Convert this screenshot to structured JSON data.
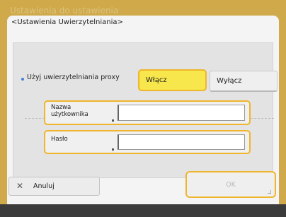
{
  "background_title": "Ustawienia do ustawienia",
  "dialog": {
    "title": "<Ustawienia Uwierzytelniania>"
  },
  "proxy": {
    "label": "Użyj uwierzytelniania proxy",
    "on_label": "Włącz",
    "off_label": "Wyłącz",
    "selected": "Włącz"
  },
  "username": {
    "label_line1": "Nazwa",
    "label_line2": "użytkownika",
    "value": ""
  },
  "password": {
    "label": "Hasło",
    "value": ""
  },
  "actions": {
    "cancel_icon": "close-icon",
    "cancel_label": "Anuluj",
    "ok_label": "OK"
  },
  "colors": {
    "accent_yellow": "#f7e64c",
    "highlight_border": "#efb52c",
    "panel_bg": "#e3e3e3",
    "page_bg": "#cfa94a"
  }
}
